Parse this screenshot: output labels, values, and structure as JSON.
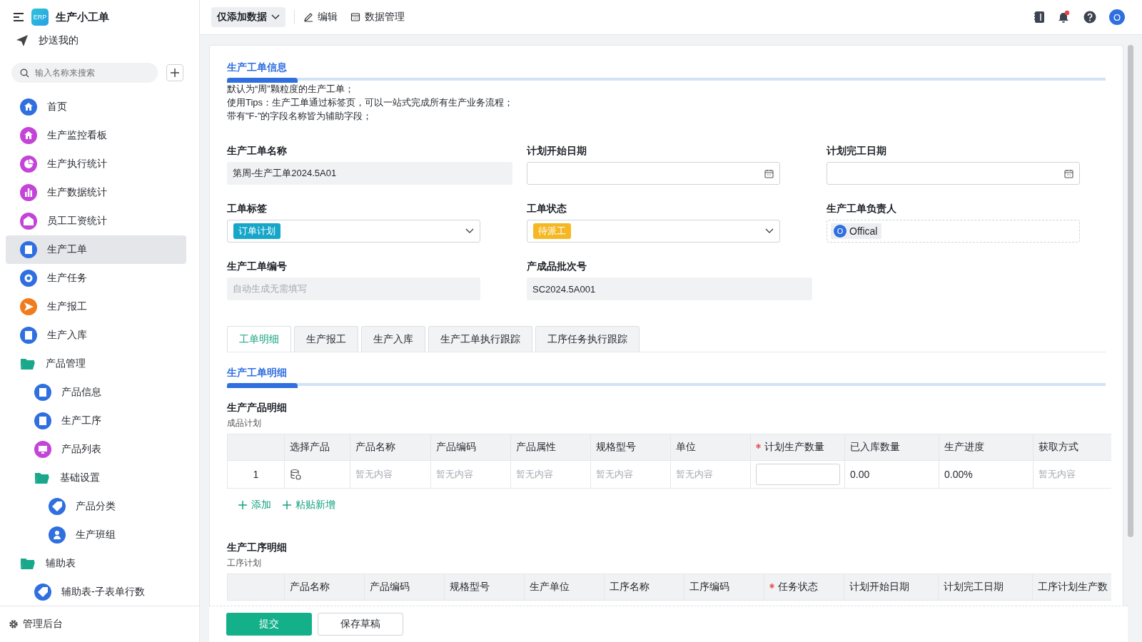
{
  "app": {
    "logo_text": "ERP",
    "title": "生产小工单",
    "cc_link": "抄送我的"
  },
  "sidebar": {
    "search": {
      "placeholder": "输入名称来搜索"
    },
    "items": [
      {
        "label": "首页",
        "kind": "home",
        "color": "#2f6fe0",
        "selected": false
      },
      {
        "label": "生产监控看板",
        "kind": "home",
        "color": "#c443d8",
        "selected": false
      },
      {
        "label": "生产执行统计",
        "kind": "pie",
        "color": "#c443d8",
        "selected": false
      },
      {
        "label": "生产数据统计",
        "kind": "bars",
        "color": "#c443d8",
        "selected": false
      },
      {
        "label": "员工工资统计",
        "kind": "wage",
        "color": "#c443d8",
        "selected": false
      },
      {
        "label": "生产工单",
        "kind": "doc",
        "color": "#2f6fe0",
        "selected": true
      },
      {
        "label": "生产任务",
        "kind": "gear",
        "color": "#2f6fe0",
        "selected": false
      },
      {
        "label": "生产报工",
        "kind": "send",
        "color": "#f07c1c",
        "selected": false
      },
      {
        "label": "生产入库",
        "kind": "clip",
        "color": "#2f6fe0",
        "selected": false
      },
      {
        "label": "产品管理",
        "kind": "folder",
        "color": "#1aa88a",
        "expanded": true,
        "selected": false,
        "children": [
          {
            "label": "产品信息",
            "kind": "clip",
            "color": "#2f6fe0",
            "selected": false
          },
          {
            "label": "生产工序",
            "kind": "doc",
            "color": "#2f6fe0",
            "selected": false
          },
          {
            "label": "产品列表",
            "kind": "monitor",
            "color": "#c443d8",
            "selected": false
          },
          {
            "label": "基础设置",
            "kind": "folder",
            "color": "#1aa88a",
            "expanded": true,
            "selected": false,
            "children": [
              {
                "label": "产品分类",
                "kind": "tag",
                "color": "#2f6fe0",
                "selected": false
              },
              {
                "label": "生产班组",
                "kind": "person",
                "color": "#2f6fe0",
                "selected": false
              }
            ]
          }
        ]
      },
      {
        "label": "辅助表",
        "kind": "folder",
        "color": "#1aa88a",
        "expanded": true,
        "selected": false,
        "children": [
          {
            "label": "辅助表-子表单行数",
            "kind": "tag",
            "color": "#2f6fe0",
            "selected": false
          }
        ]
      }
    ],
    "admin": "管理后台"
  },
  "toolbar": {
    "view_select": "仅添加数据",
    "actions": [
      {
        "label": "编辑",
        "kind": "edit"
      },
      {
        "label": "数据管理",
        "kind": "table"
      }
    ],
    "has_notification": true,
    "avatar": "O"
  },
  "form": {
    "section_title": "生产工单信息",
    "description": [
      "默认为“周”颗粒度的生产工单；",
      "使用Tips：生产工单通过标签页，可以一站式完成所有生产业务流程；",
      "带有\"F-\"的字段名称皆为辅助字段；"
    ],
    "fields": [
      {
        "label": "生产工单名称",
        "kind": "text",
        "value": "第周-生产工单2024.5A01"
      },
      {
        "label": "计划开始日期",
        "kind": "date"
      },
      {
        "label": "计划完工日期",
        "kind": "date"
      },
      {
        "label": "工单标签",
        "kind": "select",
        "value": "订单计划",
        "color": "#16a6c9"
      },
      {
        "label": "工单状态",
        "kind": "select",
        "value": "待派工",
        "color": "#f5b824"
      },
      {
        "label": "生产工单负责人",
        "kind": "user",
        "avatar": "O",
        "value": "Offical"
      },
      {
        "label": "生产工单编号",
        "kind": "readonly",
        "placeholder": "自动生成无需填写"
      },
      {
        "label": "产成品批次号",
        "kind": "text",
        "value": "SC2024.5A001"
      }
    ],
    "tabs": [
      {
        "label": "工单明细",
        "selected": true
      },
      {
        "label": "生产报工",
        "selected": false
      },
      {
        "label": "生产入库",
        "selected": false
      },
      {
        "label": "生产工单执行跟踪",
        "selected": false
      },
      {
        "label": "工序任务执行跟踪",
        "selected": false
      }
    ],
    "detail_title": "生产工单明细",
    "tables": [
      {
        "title": "生产产品明细",
        "subtitle": "成品计划",
        "columns": [
          {},
          {
            "label": "选择产品"
          },
          {
            "label": "产品名称"
          },
          {
            "label": "产品编码"
          },
          {
            "label": "产品属性"
          },
          {
            "label": "规格型号"
          },
          {
            "label": "单位"
          },
          {
            "label": "计划生产数量",
            "required": true
          },
          {
            "label": "已入库数量"
          },
          {
            "label": "生产进度"
          },
          {
            "label": "获取方式"
          }
        ],
        "rows": [
          [
            {
              "kind": "index",
              "text": "1"
            },
            {
              "kind": "picker"
            },
            {
              "kind": "empty",
              "text": "暂无内容"
            },
            {
              "kind": "empty",
              "text": "暂无内容"
            },
            {
              "kind": "empty",
              "text": "暂无内容"
            },
            {
              "kind": "empty",
              "text": "暂无内容"
            },
            {
              "kind": "empty",
              "text": "暂无内容"
            },
            {
              "kind": "input"
            },
            {
              "kind": "text",
              "text": "0.00"
            },
            {
              "kind": "text",
              "text": "0.00%"
            },
            {
              "kind": "empty",
              "text": "暂无内容"
            }
          ]
        ],
        "actions": [
          "添加",
          "粘贴新增"
        ]
      },
      {
        "title": "生产工序明细",
        "subtitle": "工序计划",
        "columns": [
          {},
          {
            "label": "产品名称"
          },
          {
            "label": "产品编码"
          },
          {
            "label": "规格型号"
          },
          {
            "label": "生产单位"
          },
          {
            "label": "工序名称"
          },
          {
            "label": "工序编码"
          },
          {
            "label": "任务状态",
            "required": true
          },
          {
            "label": "计划开始日期"
          },
          {
            "label": "计划完工日期"
          },
          {
            "label": "工序计划生产数"
          }
        ]
      }
    ]
  },
  "footer": {
    "buttons": [
      {
        "label": "提交",
        "kind": "primary"
      },
      {
        "label": "保存草稿",
        "kind": "default"
      }
    ]
  }
}
